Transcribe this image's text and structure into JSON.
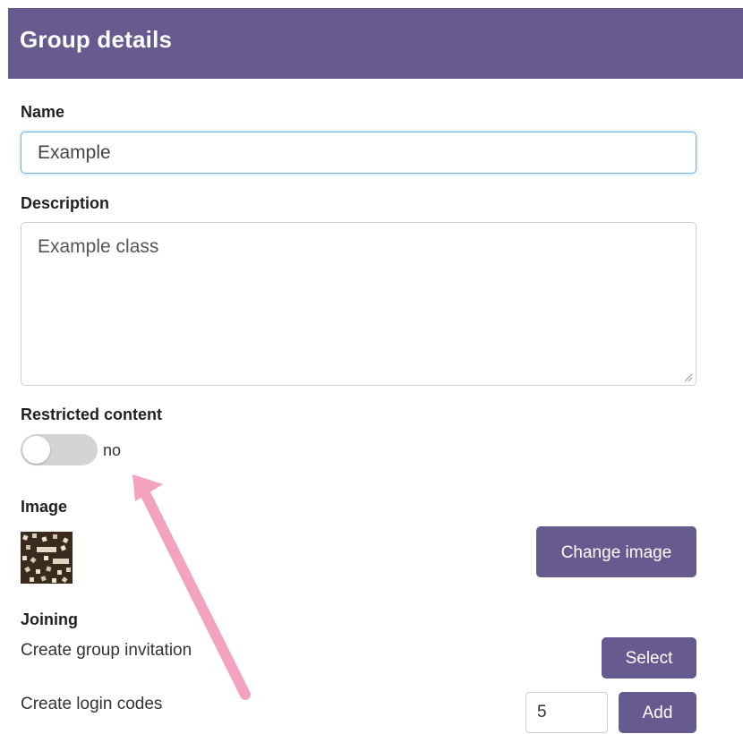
{
  "header": {
    "title": "Group details"
  },
  "name_field": {
    "label": "Name",
    "value": "Example"
  },
  "description_field": {
    "label": "Description",
    "value": "Example class"
  },
  "restricted": {
    "label": "Restricted content",
    "state_text": "no",
    "enabled": false
  },
  "image": {
    "label": "Image",
    "change_button": "Change image"
  },
  "joining": {
    "label": "Joining",
    "invitation": {
      "text": "Create group invitation",
      "button": "Select"
    },
    "login_codes": {
      "text": "Create login codes",
      "quantity": "5",
      "button": "Add"
    }
  },
  "colors": {
    "accent": "#665a8f",
    "toggle_off": "#d4d4d4",
    "annotation_arrow": "#f3a3bf"
  }
}
